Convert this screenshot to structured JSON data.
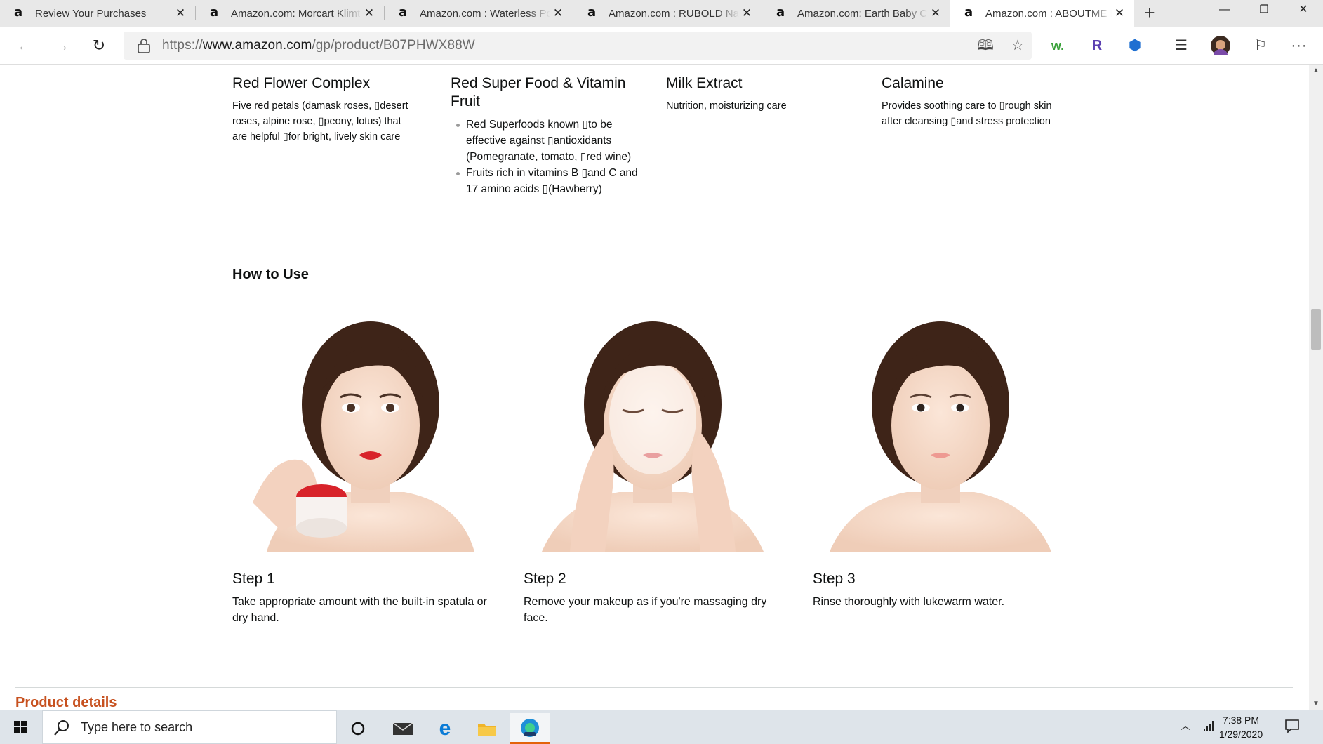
{
  "browser": {
    "tabs": [
      {
        "title": "Review Your Purchases",
        "favicon": "amazon-logo",
        "active": false
      },
      {
        "title": "Amazon.com: Morcart Klimt Ton",
        "favicon": "amazon-logo",
        "active": false
      },
      {
        "title": "Amazon.com : Waterless Portable",
        "favicon": "amazon-logo",
        "active": false
      },
      {
        "title": "Amazon.com : RUBOLD Natural",
        "favicon": "amazon-logo",
        "active": false
      },
      {
        "title": "Amazon.com: Earth Baby Comfort",
        "favicon": "amazon-logo",
        "active": false
      },
      {
        "title": "Amazon.com : ABOUTME Red",
        "favicon": "amazon-logo",
        "active": true
      }
    ],
    "favicon_letter": "a",
    "new_tab_symbol": "+",
    "url": {
      "scheme": "https://",
      "host": "www.amazon.com",
      "path": "/gp/product/B07PHWX88W"
    },
    "window_controls": {
      "minimize": "—",
      "restore": "❐",
      "close": "✕"
    }
  },
  "ingredients": [
    {
      "title": "Red Flower Complex",
      "text": "Five red petals (damask roses, ▯desert roses, alpine rose, ▯peony, lotus) that are helpful ▯for bright, lively skin care"
    },
    {
      "title": "Red Super Food & Vitamin Fruit",
      "bullets": [
        "Red Superfoods known ▯to be effective against ▯antioxidants (Pomegranate, tomato, ▯red wine)",
        "Fruits rich in vitamins B ▯and C and 17 amino acids ▯(Hawberry)"
      ]
    },
    {
      "title": "Milk Extract",
      "text": "Nutrition, moisturizing care"
    },
    {
      "title": "Calamine",
      "text": "Provides soothing care to ▯rough skin after cleansing ▯and stress protection"
    }
  ],
  "how_to_use": {
    "heading": "How to Use",
    "steps": [
      {
        "title": "Step 1",
        "desc": "Take appropriate amount with the built-in spatula or dry hand."
      },
      {
        "title": "Step 2",
        "desc": "Remove your makeup as if you're massaging dry face."
      },
      {
        "title": "Step 3",
        "desc": "Rinse thoroughly with lukewarm water."
      }
    ]
  },
  "product_details": {
    "heading": "Product details"
  },
  "taskbar": {
    "search_placeholder": "Type here to search",
    "clock_time": "7:38 PM",
    "clock_date": "1/29/2020"
  },
  "colors": {
    "link_orange": "#c7511f",
    "edge_blue": "#0a7bd6",
    "red_lip": "#d8232a"
  }
}
